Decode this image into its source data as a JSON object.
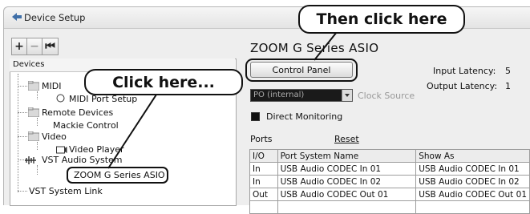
{
  "window": {
    "title": "Device Setup",
    "icon": "device-setup-icon"
  },
  "toolbar": {
    "add": "+",
    "remove": "−",
    "reset": "⏮"
  },
  "devices": {
    "header": "Devices",
    "items": [
      {
        "label": "MIDI"
      },
      {
        "label": "MIDI Port Setup"
      },
      {
        "label": "Remote Devices"
      },
      {
        "label": "Mackie Control"
      },
      {
        "label": "Video"
      },
      {
        "label": "Video Player"
      },
      {
        "label": "VST Audio System"
      },
      {
        "label": "ZOOM G Series ASIO"
      },
      {
        "label": "VST System Link"
      }
    ]
  },
  "detail": {
    "title": "ZOOM G Series ASIO",
    "control_panel": "Control Panel",
    "input_latency_label": "Input Latency:",
    "input_latency_value": "5",
    "output_latency_label": "Output Latency:",
    "output_latency_value": "1",
    "clock_source_value": "PO (internal)",
    "clock_source_label": "Clock Source",
    "direct_monitoring": "Direct Monitoring",
    "ports_label": "Ports",
    "reset_label": "Reset",
    "table": {
      "headers": [
        "I/O",
        "Port System Name",
        "Show As"
      ],
      "rows": [
        [
          "In",
          "USB Audio CODEC In 01",
          "USB Audio CODEC In 01"
        ],
        [
          "In",
          "USB Audio CODEC In 02",
          "USB Audio CODEC In 02"
        ],
        [
          "Out",
          "USB Audio CODEC Out 01",
          "USB Audio CODEC Out 01"
        ]
      ]
    }
  },
  "callouts": {
    "click_here": "Click here...",
    "then_click_here": "Then click here"
  }
}
